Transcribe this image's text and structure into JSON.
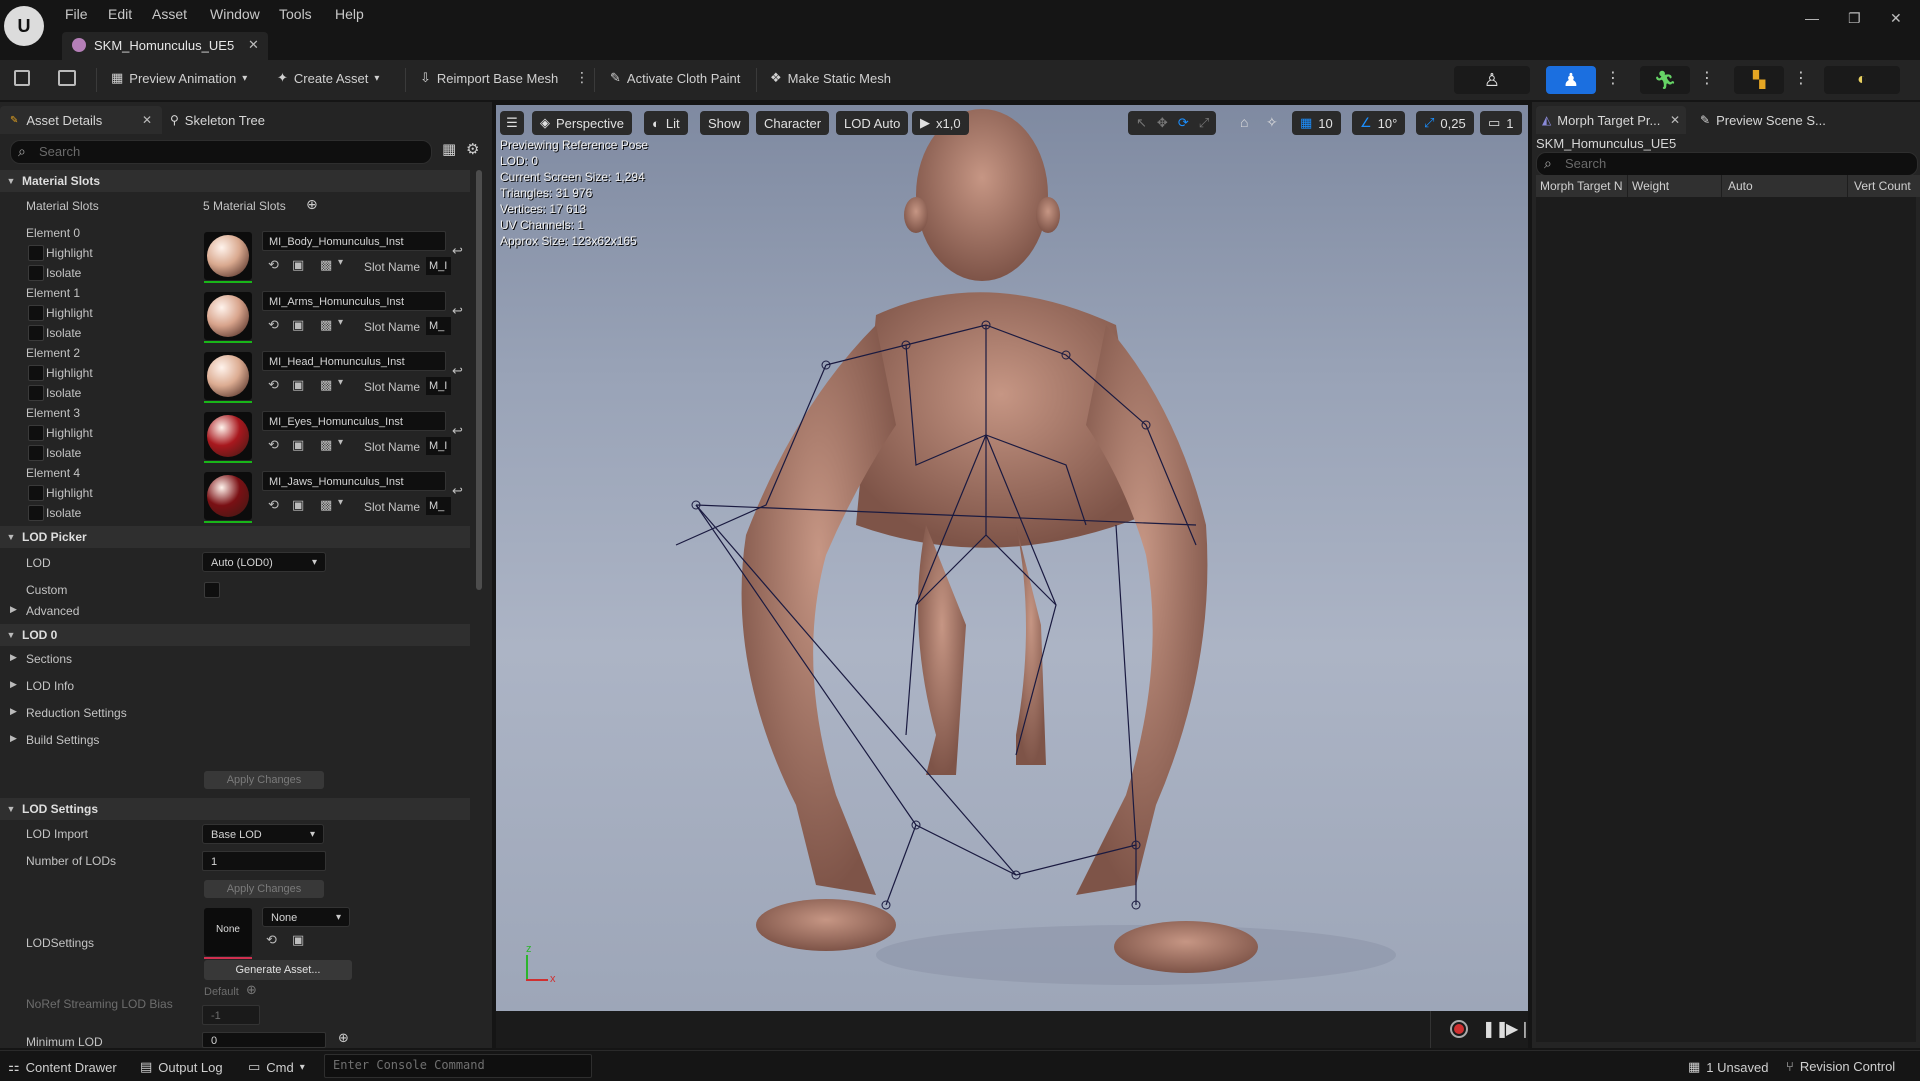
{
  "app": {
    "menu": [
      "File",
      "Edit",
      "Asset",
      "Window",
      "Tools",
      "Help"
    ],
    "document_tab": "SKM_Homunculus_UE5"
  },
  "toolbar": {
    "preview_animation": "Preview Animation",
    "create_asset": "Create Asset",
    "reimport": "Reimport Base Mesh",
    "activate_cloth": "Activate Cloth Paint",
    "make_static": "Make Static Mesh"
  },
  "left_panel": {
    "tabs": [
      "Asset Details",
      "Skeleton Tree"
    ],
    "search_placeholder": "Search",
    "material_slots": {
      "section": "Material Slots",
      "label": "Material Slots",
      "count_text": "5 Material Slots",
      "highlight_label": "Highlight",
      "isolate_label": "Isolate",
      "slot_name_label": "Slot Name",
      "elements": [
        {
          "label": "Element 0",
          "material": "MI_Body_Homunculus_Inst",
          "slot": "M_I",
          "color": "#d9a98f"
        },
        {
          "label": "Element 1",
          "material": "MI_Arms_Homunculus_Inst",
          "slot": "M_",
          "color": "#d8a48c"
        },
        {
          "label": "Element 2",
          "material": "MI_Head_Homunculus_Inst",
          "slot": "M_I",
          "color": "#dcac92"
        },
        {
          "label": "Element 3",
          "material": "MI_Eyes_Homunculus_Inst",
          "slot": "M_I",
          "color": "#a8181e"
        },
        {
          "label": "Element 4",
          "material": "MI_Jaws_Homunculus_Inst",
          "slot": "M_",
          "color": "#7a1014"
        }
      ]
    },
    "lod_picker": {
      "section": "LOD Picker",
      "lod_label": "LOD",
      "lod_value": "Auto (LOD0)",
      "custom_label": "Custom",
      "advanced": "Advanced"
    },
    "lod0": {
      "section": "LOD 0",
      "items": [
        "Sections",
        "LOD Info",
        "Reduction Settings",
        "Build Settings"
      ],
      "apply": "Apply Changes"
    },
    "lod_settings": {
      "section": "LOD Settings",
      "lod_import_label": "LOD Import",
      "lod_import_value": "Base LOD",
      "num_lods_label": "Number of LODs",
      "num_lods_value": "1",
      "apply": "Apply Changes",
      "lodsettings_label": "LODSettings",
      "lodsettings_thumb": "None",
      "lodsettings_value": "None",
      "generate": "Generate Asset...",
      "noref_label": "NoRef Streaming LOD Bias",
      "noref_default": "Default",
      "noref_value": "-1",
      "min_lod_label": "Minimum LOD",
      "min_lod_value": "0"
    }
  },
  "viewport": {
    "menu_icon": "hamburger-icon",
    "perspective": "Perspective",
    "lit": "Lit",
    "show": "Show",
    "character": "Character",
    "lod": "LOD Auto",
    "speed": "x1,0",
    "grid_value": "10",
    "angle_value": "10°",
    "scale_value": "0,25",
    "camera_value": "1",
    "overlay": [
      "Previewing Reference Pose",
      "LOD: 0",
      "Current Screen Size: 1,294",
      "Triangles: 31 976",
      "Vertices: 17 613",
      "UV Channels: 1",
      "Approx Size: 123x62x165"
    ],
    "axis_z": "z",
    "axis_x": "x"
  },
  "right_panel": {
    "tabs": [
      "Morph Target Pr...",
      "Preview Scene S..."
    ],
    "asset_name": "SKM_Homunculus_UE5",
    "search_placeholder": "Search",
    "columns": [
      "Morph Target N",
      "Weight",
      "Auto",
      "Vert Count"
    ]
  },
  "statusbar": {
    "content_drawer": "Content Drawer",
    "output_log": "Output Log",
    "cmd": "Cmd",
    "console_placeholder": "Enter Console Command",
    "unsaved": "1 Unsaved",
    "revision": "Revision Control"
  }
}
